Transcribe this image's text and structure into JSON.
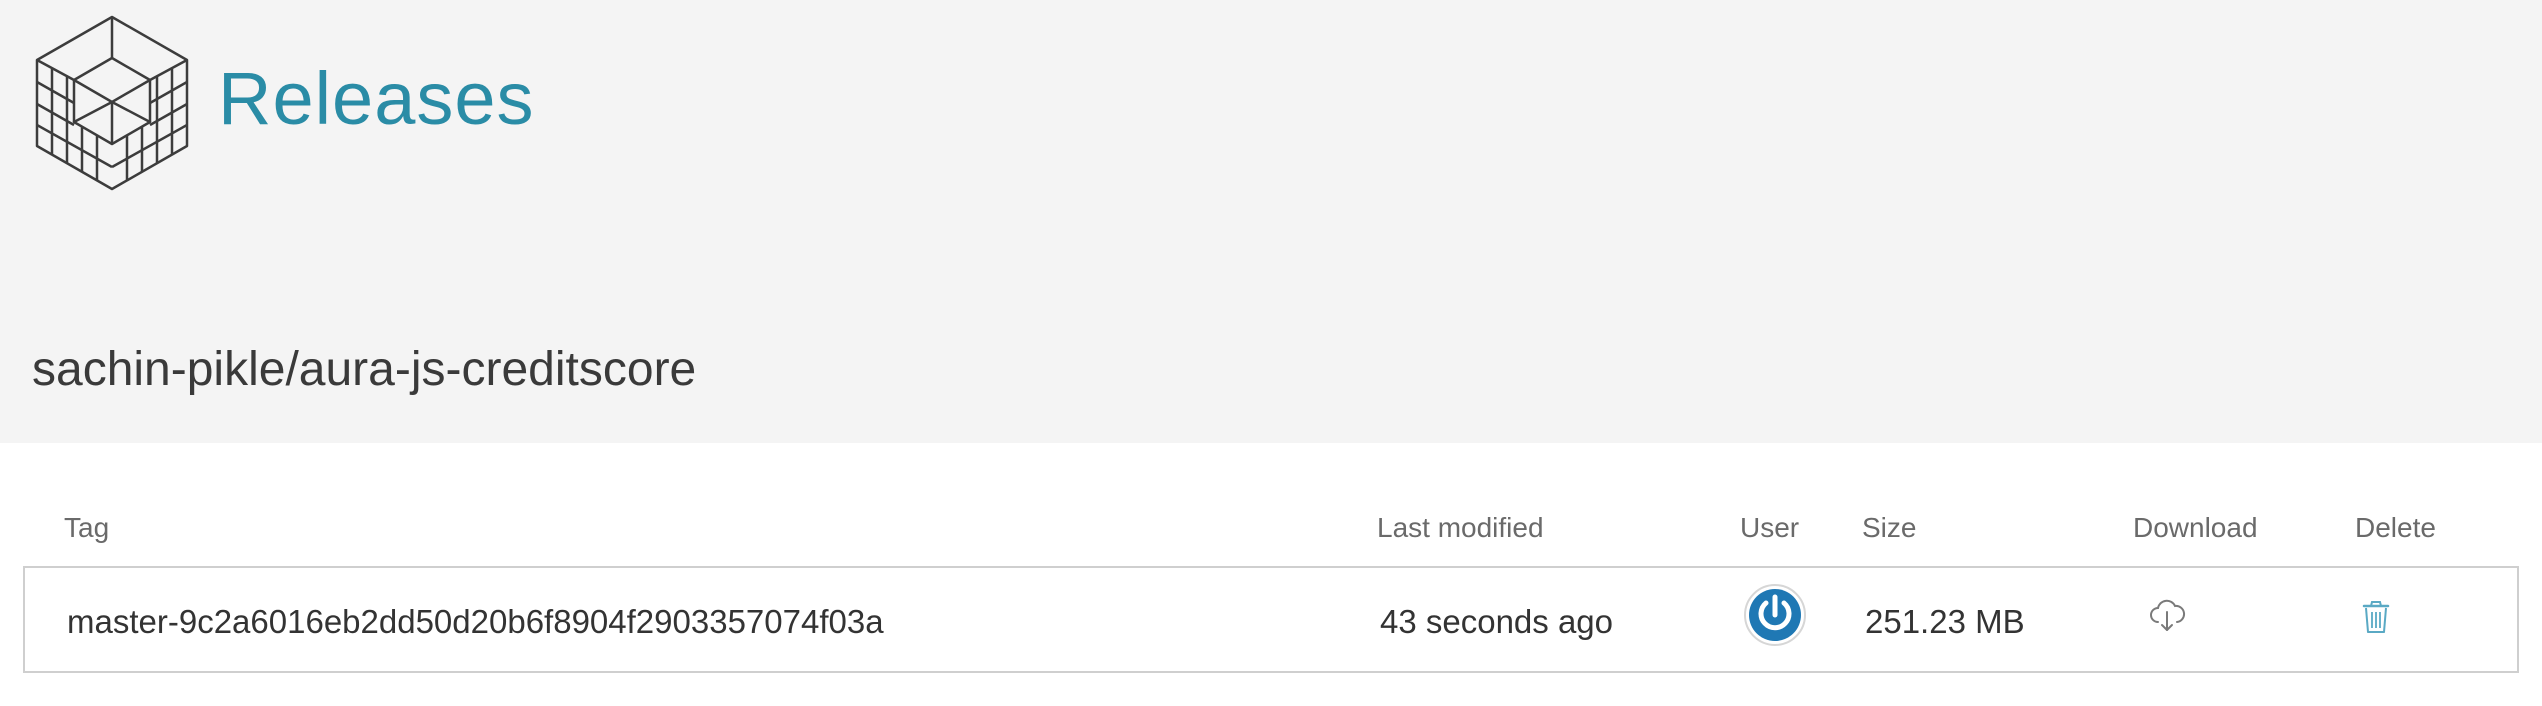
{
  "header": {
    "title": "Releases",
    "repository": "sachin-pikle/aura-js-creditscore"
  },
  "table": {
    "columns": {
      "tag": "Tag",
      "last_modified": "Last modified",
      "user": "User",
      "size": "Size",
      "download": "Download",
      "delete": "Delete"
    },
    "rows": [
      {
        "tag": "master-9c2a6016eb2dd50d20b6f8904f2903357074f03a",
        "last_modified": "43 seconds ago",
        "size": "251.23 MB",
        "user_icon": "power-icon",
        "download_icon": "cloud-download-icon",
        "delete_icon": "trash-icon"
      }
    ]
  },
  "colors": {
    "title": "#2a8ca6",
    "header_bg": "#f4f4f4",
    "avatar_blue": "#1f78b4",
    "icon_teal": "#5aa9c4"
  }
}
